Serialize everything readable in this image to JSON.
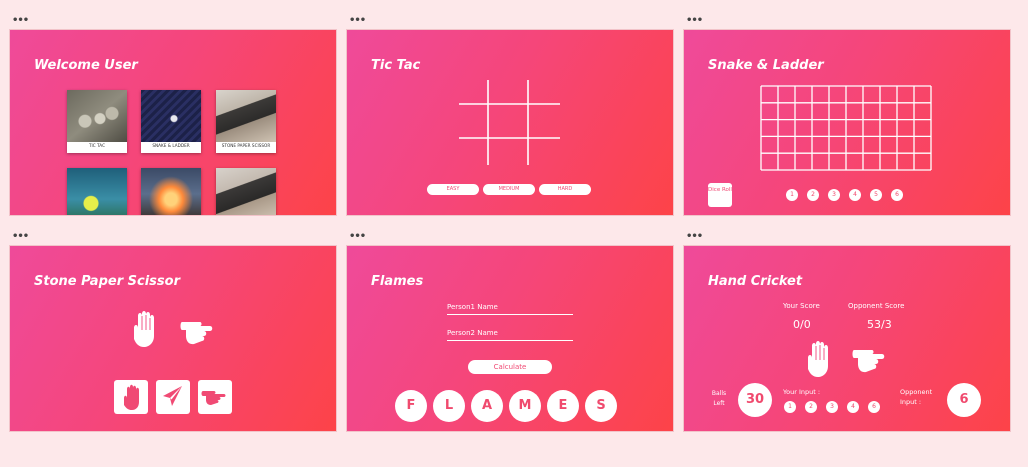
{
  "colors": {
    "bg": "#fde8ea",
    "card_start": "#ef4a9a",
    "card_end": "#fd4348",
    "accent": "#f04a74"
  },
  "welcome": {
    "title": "Welcome User",
    "games": [
      {
        "label": "TIC TAC",
        "image": "pebbles-photo"
      },
      {
        "label": "SNAKE & LADDER",
        "image": "dice-photo"
      },
      {
        "label": "STONE PAPER SCISSOR",
        "image": "hands-photo"
      },
      {
        "label": "",
        "image": "tennis-ball-photo"
      },
      {
        "label": "",
        "image": "fire-photo"
      },
      {
        "label": "",
        "image": "phone-photo"
      }
    ]
  },
  "tictac": {
    "title": "Tic Tac",
    "levels": [
      "EASY",
      "MEDIUM",
      "HARD"
    ]
  },
  "snake": {
    "title": "Snake & Ladder",
    "dice_label": "Dice Roll",
    "numbers": [
      "1",
      "2",
      "3",
      "4",
      "5",
      "6"
    ]
  },
  "sps": {
    "title": "Stone Paper Scissor",
    "choices": [
      "paper-hand-icon",
      "send-icon",
      "scissors-hand-icon"
    ]
  },
  "flames": {
    "title": "Flames",
    "person1_placeholder": "Person1 Name",
    "person2_placeholder": "Person2 Name",
    "calculate_label": "Calculate",
    "letters": [
      "F",
      "L",
      "A",
      "M",
      "E",
      "S"
    ]
  },
  "cricket": {
    "title": "Hand Cricket",
    "your_score_label": "Your Score",
    "your_score": "0/0",
    "opp_score_label": "Opponent Score",
    "opp_score": "53/3",
    "balls_label": "Balls Left",
    "balls_left": "30",
    "input_label": "Your Input :",
    "inputs": [
      "1",
      "2",
      "3",
      "4",
      "6"
    ],
    "opp_input_label": "Opponent Input :",
    "opp_input": "6"
  }
}
